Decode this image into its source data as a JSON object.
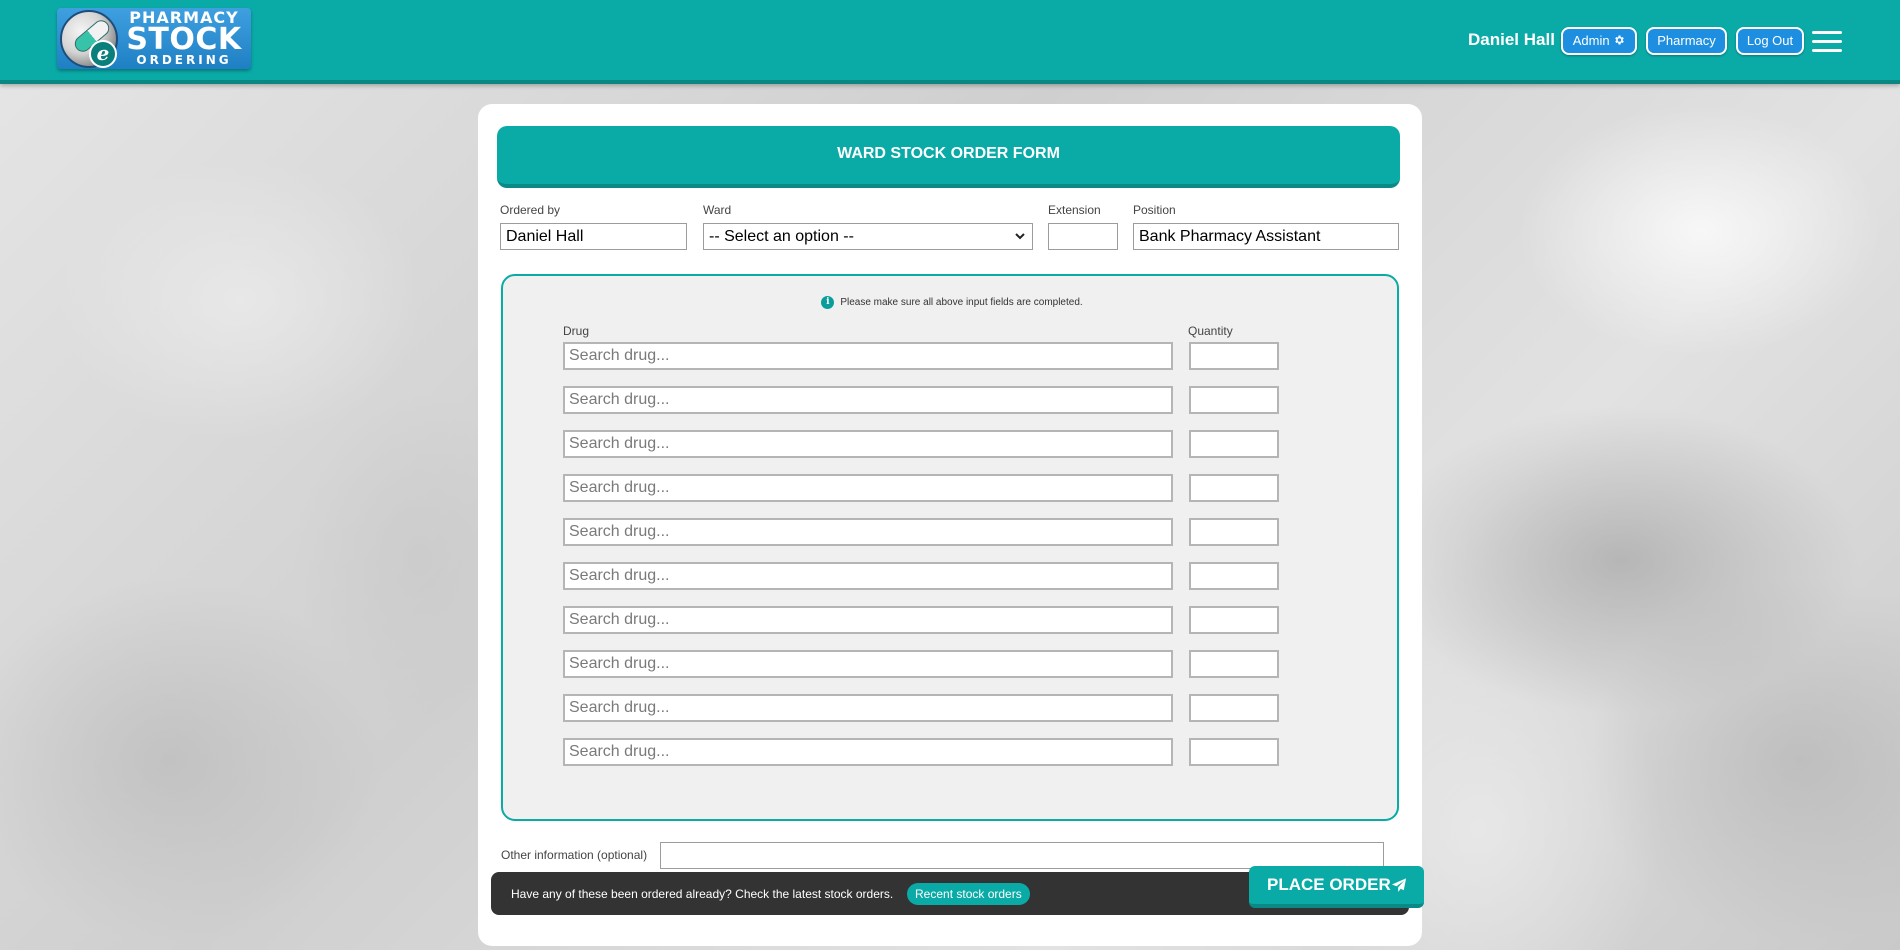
{
  "app": {
    "logo": {
      "line1": "PHARMACY",
      "line2": "STOCK",
      "line3": "ORDERING"
    },
    "colors": {
      "primary": "#0aaba7",
      "primary_dark": "#0a8986",
      "header_button": "#1e8fe0",
      "footer": "#333333"
    }
  },
  "header": {
    "user_name": "Daniel Hall",
    "buttons": {
      "admin": "Admin",
      "pharmacy": "Pharmacy",
      "logout": "Log Out"
    },
    "icons": {
      "admin": "gear-icon",
      "menu": "hamburger-menu-icon"
    }
  },
  "form": {
    "title": "WARD STOCK ORDER FORM",
    "labels": {
      "ordered_by": "Ordered by",
      "ward": "Ward",
      "extension": "Extension",
      "position": "Position"
    },
    "values": {
      "ordered_by": "Daniel Hall",
      "ward": "-- Select an option --",
      "extension": "",
      "position": "Bank Pharmacy Assistant"
    },
    "notice": "Please make sure all above input fields are completed.",
    "columns": {
      "drug": "Drug",
      "quantity": "Quantity"
    },
    "drug_placeholder": "Search drug...",
    "rows": [
      {
        "drug": "",
        "quantity": ""
      },
      {
        "drug": "",
        "quantity": ""
      },
      {
        "drug": "",
        "quantity": ""
      },
      {
        "drug": "",
        "quantity": ""
      },
      {
        "drug": "",
        "quantity": ""
      },
      {
        "drug": "",
        "quantity": ""
      },
      {
        "drug": "",
        "quantity": ""
      },
      {
        "drug": "",
        "quantity": ""
      },
      {
        "drug": "",
        "quantity": ""
      },
      {
        "drug": "",
        "quantity": ""
      }
    ],
    "other_info_label": "Other information (optional)",
    "other_info_value": ""
  },
  "footer": {
    "text": "Have any of these been ordered already? Check the latest stock orders.",
    "recent_button": "Recent stock orders",
    "place_order": "PLACE ORDER",
    "place_order_icon": "paper-plane-icon"
  }
}
